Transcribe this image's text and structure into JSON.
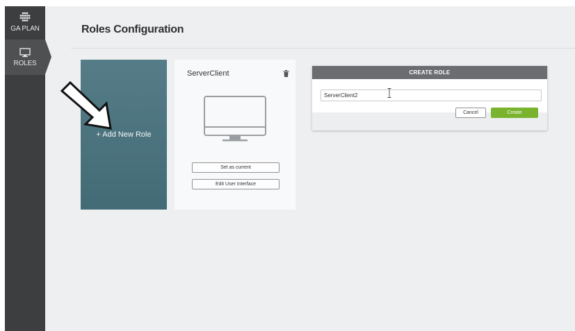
{
  "sidebar": {
    "items": [
      {
        "label": "GA PLAN",
        "icon": "grid-dots-icon"
      },
      {
        "label": "ROLES",
        "icon": "monitor-icon",
        "active": true
      }
    ]
  },
  "header": {
    "title": "Roles Configuration"
  },
  "add_role": {
    "label": "+ Add New Role"
  },
  "role_card": {
    "name": "ServerClient",
    "set_current_label": "Set as current",
    "edit_ui_label": "Edit User Interface"
  },
  "dialog": {
    "title": "CREATE ROLE",
    "input_value": "ServerClient2",
    "cancel_label": "Cancel",
    "create_label": "Create"
  },
  "colors": {
    "sidebar_bg": "#3d3e40",
    "add_tile": "#4e7580",
    "create_button": "#7ab42f",
    "dialog_header": "#6b6d70"
  }
}
